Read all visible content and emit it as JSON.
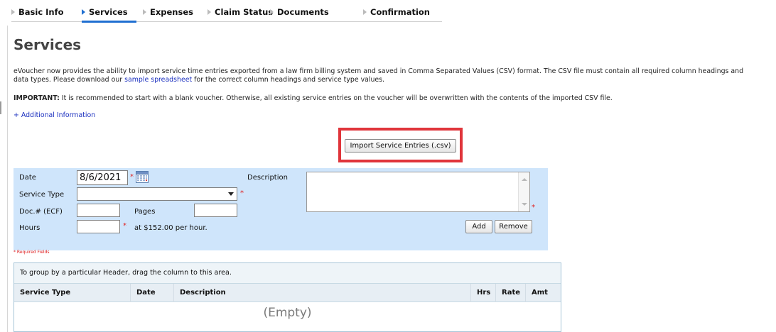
{
  "tabs": [
    {
      "label": "Basic Info",
      "active": false
    },
    {
      "label": "Services",
      "active": true
    },
    {
      "label": "Expenses",
      "active": false
    },
    {
      "label": "Claim Status",
      "active": false
    },
    {
      "label": "Documents",
      "active": false
    },
    {
      "label": "Confirmation",
      "active": false
    }
  ],
  "page_title": "Services",
  "intro": {
    "line1": "eVoucher now provides the ability to import service time entries exported from a law firm billing system and saved in Comma Separated Values (CSV) format. The CSV file must contain all required column headings and",
    "line2_pre": "data types. Please download our ",
    "line2_link": "sample spreadsheet",
    "line2_post": " for the correct column headings and service type values."
  },
  "important": {
    "label": "IMPORTANT:",
    "text": " It is recommended to start with a blank voucher. Otherwise, all existing service entries on the voucher will be overwritten with the contents of the imported CSV file."
  },
  "additional_info_link": "+ Additional Information",
  "import_button": "Import Service Entries (.csv)",
  "form": {
    "date_label": "Date",
    "date_value": "8/6/2021",
    "service_type_label": "Service Type",
    "service_type_value": "",
    "doc_label": "Doc.# (ECF)",
    "doc_value": "",
    "pages_label": "Pages",
    "pages_value": "",
    "hours_label": "Hours",
    "hours_value": "",
    "rate_text": "at $152.00 per hour.",
    "description_label": "Description",
    "description_value": "",
    "add_button": "Add",
    "remove_button": "Remove",
    "required_note": "* Required Fields",
    "required_marker": "*"
  },
  "grid": {
    "group_hint": "To group by a particular Header, drag the column to this area.",
    "columns": [
      "Service Type",
      "Date",
      "Description",
      "Hrs",
      "Rate",
      "Amt"
    ],
    "empty_text": "(Empty)"
  },
  "colors": {
    "accent": "#1f6fd1",
    "form_bg": "#cfe5fb",
    "highlight": "#e0353b",
    "required": "#e02020"
  }
}
